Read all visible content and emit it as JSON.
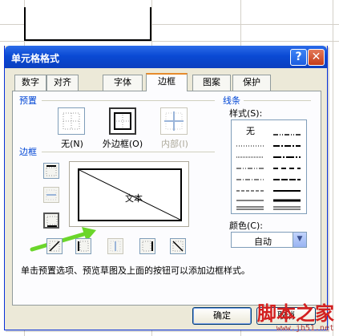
{
  "dialog": {
    "title": "单元格格式",
    "help_label": "?",
    "close_label": "✕"
  },
  "tabs": [
    {
      "label": "数字",
      "active": false
    },
    {
      "label": "对齐",
      "active": false
    },
    {
      "label": "字体",
      "active": false
    },
    {
      "label": "边框",
      "active": true
    },
    {
      "label": "图案",
      "active": false
    },
    {
      "label": "保护",
      "active": false
    }
  ],
  "presets": {
    "group_label": "预置",
    "none_label": "无(N)",
    "outline_label": "外边框(O)",
    "inside_label": "内部(I)"
  },
  "border": {
    "group_label": "边框",
    "preview_text": "文本"
  },
  "line": {
    "group_label": "线条",
    "style_label": "样式(S):",
    "none_style": "无",
    "color_label": "颜色(C):",
    "color_value": "自动"
  },
  "hint": "单击预置选项、预览草图及上面的按钮可以添加边框样式。",
  "buttons": {
    "ok_label": "确定",
    "cancel_label": "取消"
  },
  "watermark": {
    "title": "脚本之家",
    "url": "www.jb51.net"
  },
  "colors": {
    "titlebar": "#0a4ad4",
    "arrow": "#6bd62b",
    "group_label": "#0046d5",
    "tab_highlight": "#e68b2c"
  }
}
